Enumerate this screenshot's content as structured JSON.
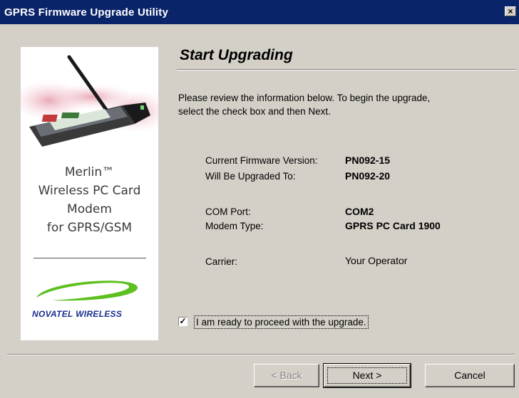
{
  "window": {
    "title": "GPRS Firmware Upgrade Utility",
    "close_glyph": "×"
  },
  "side_panel": {
    "product_lines": [
      "Merlin™",
      "Wireless PC Card",
      "Modem",
      "for GPRS/GSM"
    ],
    "brand": "NOVATEL WIRELESS"
  },
  "page": {
    "heading": "Start Upgrading",
    "instructions_line1": "Please review the information below.  To begin the upgrade,",
    "instructions_line2": "select the check box and then Next."
  },
  "info": {
    "current_label": "Current Firmware Version:",
    "current_value": "PN092-15",
    "upgraded_label": "Will Be Upgraded To:",
    "upgraded_value": "PN092-20",
    "port_label": "COM Port:",
    "port_value": "COM2",
    "modem_label": "Modem Type:",
    "modem_value": "GPRS PC Card 1900",
    "carrier_label": "Carrier:",
    "carrier_value": "Your Operator"
  },
  "confirm": {
    "checked": true,
    "check_glyph": "✓",
    "label": "I am ready to proceed with the upgrade."
  },
  "buttons": {
    "back": "< Back",
    "next": "Next >",
    "cancel": "Cancel"
  },
  "colors": {
    "title_bar": "#0a246a",
    "dialog_bg": "#d4d0c8",
    "brand_blue": "#1a2f8e",
    "logo_green": "#5cc01e"
  }
}
